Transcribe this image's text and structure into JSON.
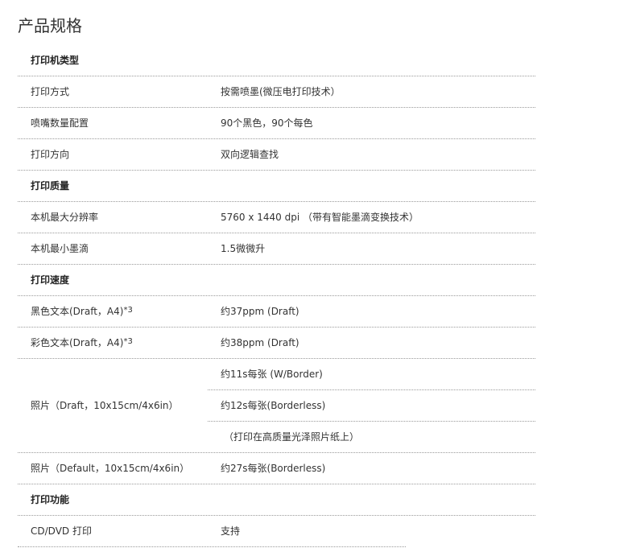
{
  "title": "产品规格",
  "sections": {
    "printer_type": {
      "heading": "打印机类型",
      "rows": [
        {
          "label": "打印方式",
          "value": "按需喷墨(微压电打印技术）"
        },
        {
          "label": "喷嘴数量配置",
          "value": "90个黑色，90个每色"
        },
        {
          "label": "打印方向",
          "value": "双向逻辑查找"
        }
      ]
    },
    "print_quality": {
      "heading": "打印质量",
      "rows": [
        {
          "label": "本机最大分辨率",
          "value": "5760 x 1440 dpi （带有智能墨滴变换技术）"
        },
        {
          "label": "本机最小墨滴",
          "value": "1.5微微升"
        }
      ]
    },
    "print_speed": {
      "heading": "打印速度",
      "rows": [
        {
          "label": "黑色文本(Draft，A4)",
          "sup": "*3",
          "value": "约37ppm (Draft)"
        },
        {
          "label": "彩色文本(Draft，A4)",
          "sup": "*3",
          "value": "约38ppm (Draft)"
        }
      ],
      "photo_draft": {
        "label": "照片（Draft，10x15cm/4x6in）",
        "values": [
          "约11s每张 (W/Border)",
          "约12s每张(Borderless)",
          "（打印在高质量光泽照片纸上）"
        ]
      },
      "photo_default": {
        "label": "照片（Default，10x15cm/4x6in）",
        "value": "约27s每张(Borderless)"
      }
    },
    "print_features": {
      "heading": "打印功能",
      "rows": [
        {
          "label": "CD/DVD 打印",
          "value": "支持"
        }
      ]
    }
  }
}
